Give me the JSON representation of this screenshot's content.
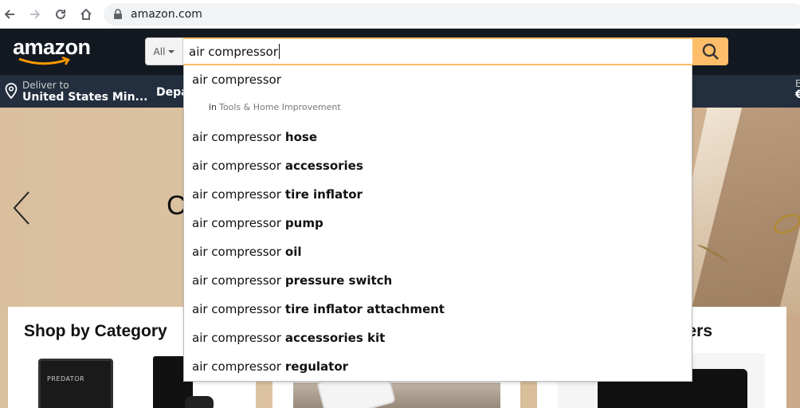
{
  "browser": {
    "url": "amazon.com"
  },
  "header": {
    "logo_text": "amazon",
    "search_category": "All",
    "search_query": "air compressor",
    "deliver_line1": "Deliver to",
    "deliver_line2": "United States Min...",
    "departments_stub": "Depa",
    "right_stub_line1": "E",
    "right_stub_line2": "€"
  },
  "hero": {
    "partial_heading": "C",
    "cards": [
      {
        "title": "Shop by Category",
        "laptop_brand": "PREDATOR"
      },
      {
        "title": ""
      },
      {
        "title": "ers"
      }
    ]
  },
  "suggestions": [
    {
      "prefix": "air compressor",
      "suffix": ""
    },
    {
      "prefix": "air compressor",
      "suffix": "hose"
    },
    {
      "prefix": "air compressor",
      "suffix": "accessories"
    },
    {
      "prefix": "air compressor",
      "suffix": "tire inflator"
    },
    {
      "prefix": "air compressor",
      "suffix": "pump"
    },
    {
      "prefix": "air compressor",
      "suffix": "oil"
    },
    {
      "prefix": "air compressor",
      "suffix": "pressure switch"
    },
    {
      "prefix": "air compressor",
      "suffix": "tire inflator attachment"
    },
    {
      "prefix": "air compressor",
      "suffix": "accessories kit"
    },
    {
      "prefix": "air compressor",
      "suffix": "regulator"
    }
  ],
  "suggestion_department": {
    "in_label": "in",
    "name": "Tools & Home Improvement"
  },
  "colors": {
    "header_bg": "#131921",
    "subbar_bg": "#232f3e",
    "search_button": "#febd69",
    "logo_smile": "#ff9900"
  },
  "icons": {
    "back": "arrow-left-icon",
    "forward": "arrow-right-icon",
    "reload": "reload-icon",
    "home": "home-icon",
    "lock": "lock-icon",
    "search": "search-icon",
    "location": "location-pin-icon",
    "carousel_prev": "chevron-left-icon"
  }
}
